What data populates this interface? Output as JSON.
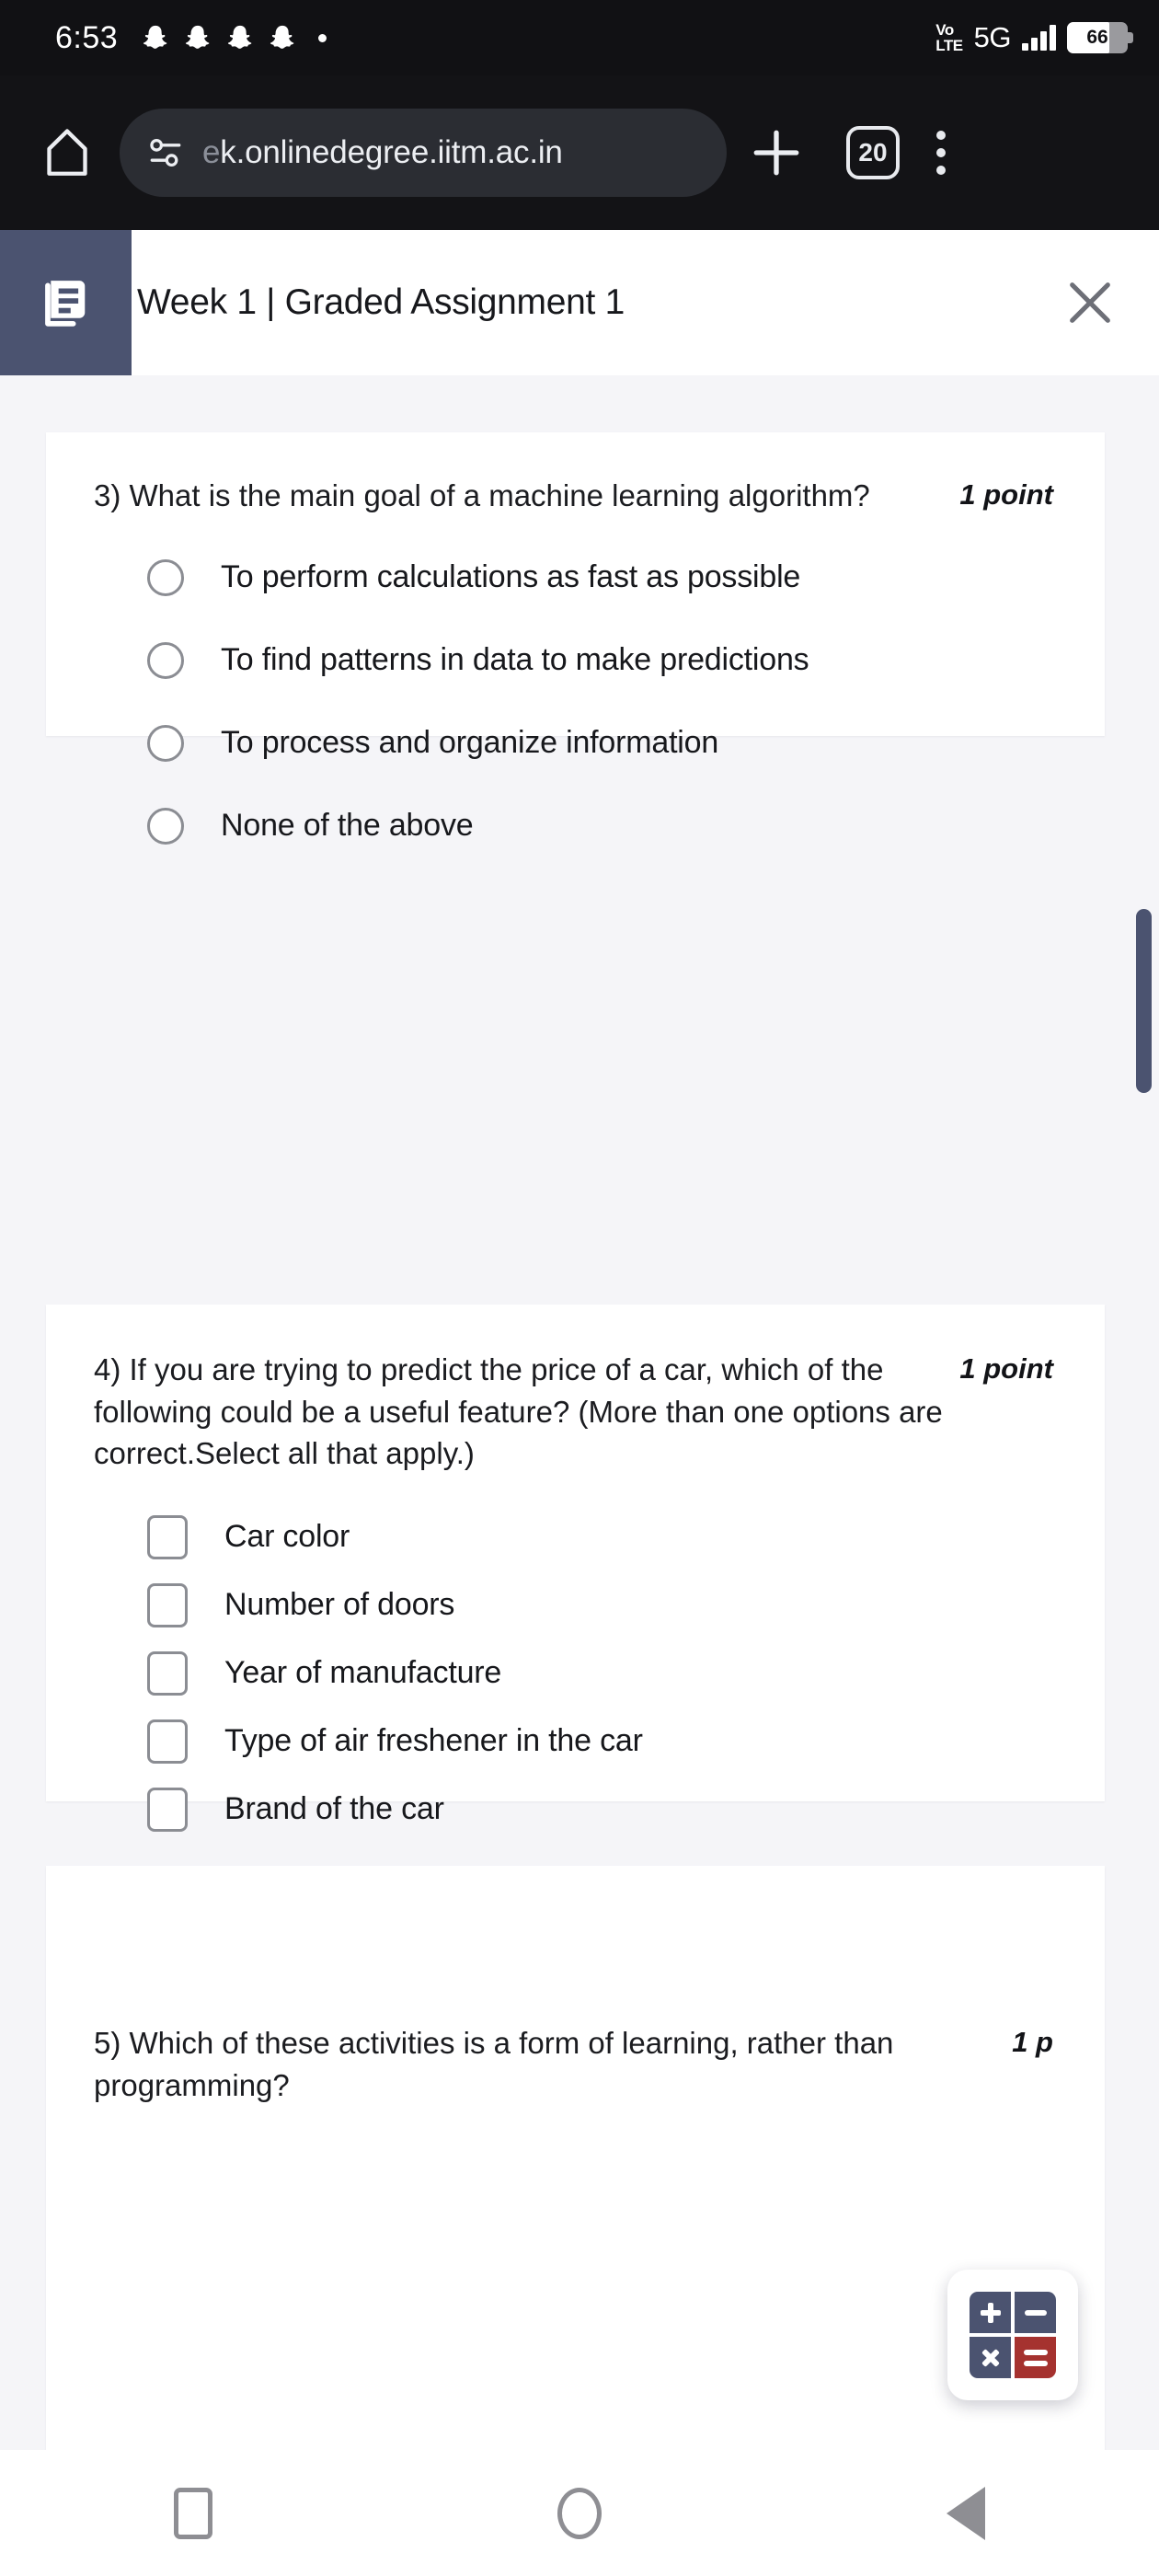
{
  "status_bar": {
    "time": "6:53",
    "notification_icons": [
      "snapchat-ghost",
      "snapchat-ghost",
      "snapchat-ghost",
      "snapchat-ghost",
      "dot"
    ],
    "volte_top": "VoLTE",
    "network": "5G",
    "signal_icon": "signal-bars-icon",
    "battery_percent": "66"
  },
  "browser_bar": {
    "home_icon": "home-icon",
    "site_settings_icon": "site-settings-icon",
    "url_prefix": "e",
    "url": "k.onlinedegree.iitm.ac.in",
    "url_full": "ek.onlinedegree.iitm.ac.in",
    "new_tab_icon": "plus-icon",
    "tab_count": "20",
    "menu_icon": "kebab-menu-icon"
  },
  "assignment_header": {
    "icon": "document-article-icon",
    "title": "Week 1 | Graded Assignment 1",
    "close_icon": "close-icon"
  },
  "questions": [
    {
      "number": "3)",
      "text": "What is the main goal of a machine learning algorithm?",
      "points": "1 point",
      "input_type": "radio",
      "options": [
        "To perform calculations as fast as possible",
        "To find patterns in data to make predictions",
        "To process and organize information",
        "None of the above"
      ]
    },
    {
      "number": "4)",
      "text": "If you are trying to predict the price of a car, which of the following could be a useful feature? (More than one options are correct.Select all that apply.)",
      "points": "1 point",
      "input_type": "checkbox",
      "options": [
        "Car color",
        "Number of doors",
        "Year of manufacture",
        "Type of air freshener in the car",
        "Brand of the car"
      ]
    },
    {
      "number": "5)",
      "text": "Which of these activities is a form of learning, rather than programming?",
      "points": "1 p",
      "input_type": "radio",
      "options": []
    }
  ],
  "calculator_fab": {
    "icon": "calculator-icon",
    "keys": [
      "+",
      "−",
      "×",
      "="
    ],
    "accent_color": "#4b5370",
    "equals_color": "#a5322f"
  },
  "nav_bar": {
    "recents_icon": "recents-square-icon",
    "home_icon": "home-circle-icon",
    "back_icon": "back-triangle-icon"
  },
  "scrollbar": {
    "name": "vertical-scrollbar-thumb"
  }
}
